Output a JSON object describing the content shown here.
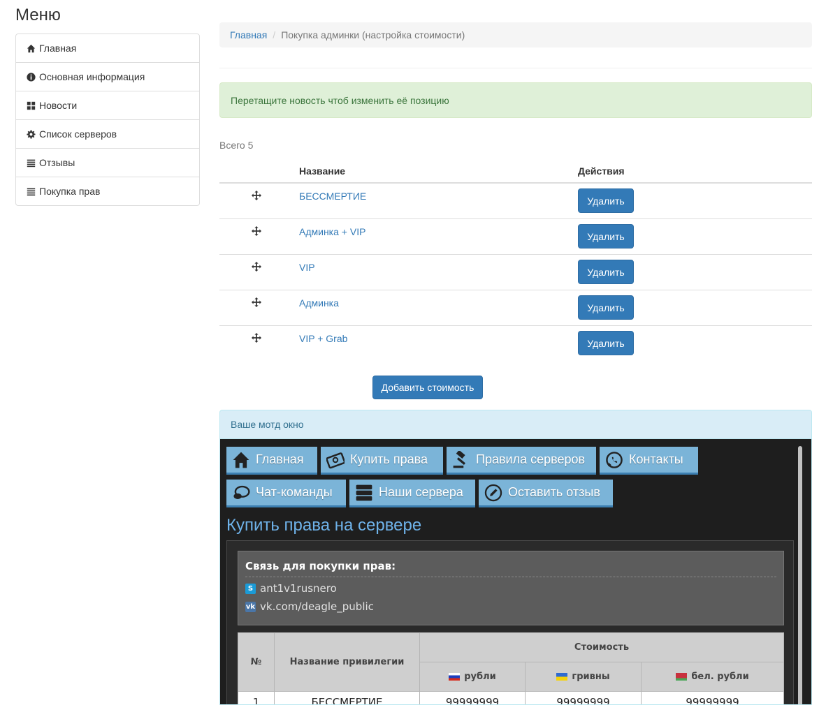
{
  "menu": {
    "title": "Меню",
    "items": [
      {
        "label": "Главная",
        "icon": "home-icon"
      },
      {
        "label": "Основная информация",
        "icon": "info-icon"
      },
      {
        "label": "Новости",
        "icon": "grid-icon"
      },
      {
        "label": "Список серверов",
        "icon": "gear-icon"
      },
      {
        "label": "Отзывы",
        "icon": "list-icon"
      },
      {
        "label": "Покупка прав",
        "icon": "list-icon"
      }
    ]
  },
  "breadcrumb": {
    "home": "Главная",
    "current": "Покупка админки (настройка стоимости)"
  },
  "alert": "Перетащите новость чтоб изменить её позицию",
  "total": "Всего 5",
  "table": {
    "headers": {
      "name": "Название",
      "actions": "Действия"
    },
    "rows": [
      {
        "name": "БЕССМЕРТИЕ",
        "action": "Удалить"
      },
      {
        "name": "Админка + VIP",
        "action": "Удалить"
      },
      {
        "name": "VIP",
        "action": "Удалить"
      },
      {
        "name": "Админка",
        "action": "Удалить"
      },
      {
        "name": "VIP + Grab",
        "action": "Удалить"
      }
    ]
  },
  "add_button": "Добавить стоимость",
  "motd_panel_title": "Ваше мотд окно",
  "motd": {
    "nav": [
      {
        "label": "Главная",
        "icon": "home-icon"
      },
      {
        "label": "Купить права",
        "icon": "money-icon"
      },
      {
        "label": "Правила серверов",
        "icon": "gavel-icon"
      },
      {
        "label": "Контакты",
        "icon": "whatsapp-icon"
      },
      {
        "label": "Чат-команды",
        "icon": "chat-icon"
      },
      {
        "label": "Наши сервера",
        "icon": "server-icon"
      },
      {
        "label": "Оставить отзыв",
        "icon": "edit-icon"
      }
    ],
    "heading": "Купить права на сервере",
    "contact": {
      "title": "Связь для покупки прав:",
      "skype": "ant1v1rusnero",
      "vk": "vk.com/deagle_public"
    },
    "price_table": {
      "col_num": "№",
      "col_name": "Название привилегии",
      "col_cost": "Стоимость",
      "currencies": [
        "рубли",
        "гривны",
        "бел. рубли"
      ],
      "rows": [
        {
          "num": "1",
          "name": "БЕССМЕРТИЕ",
          "rub": "99999999",
          "uah": "99999999",
          "byr": "99999999"
        }
      ]
    }
  }
}
